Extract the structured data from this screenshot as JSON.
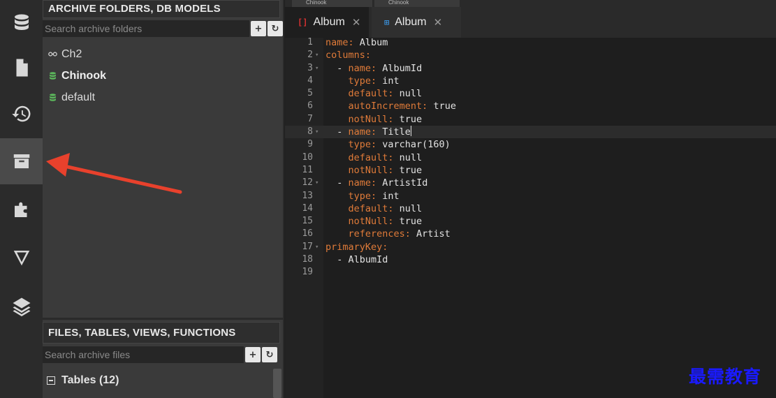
{
  "rail": {
    "items": [
      {
        "icon": "database-icon"
      },
      {
        "icon": "document-icon"
      },
      {
        "icon": "history-icon"
      },
      {
        "icon": "archive-icon",
        "active": true
      },
      {
        "icon": "puzzle-icon"
      },
      {
        "icon": "filter-icon"
      },
      {
        "icon": "layers-icon"
      }
    ]
  },
  "archive_panel": {
    "title": "ARCHIVE FOLDERS, DB MODELS",
    "search_placeholder": "Search archive folders",
    "add_label": "+",
    "refresh_label": "↻",
    "folders": [
      {
        "label": "Ch2",
        "icon": "link-icon",
        "bold": false
      },
      {
        "label": "Chinook",
        "icon": "db-green-icon",
        "bold": true
      },
      {
        "label": "default",
        "icon": "db-green-icon",
        "bold": false
      }
    ]
  },
  "files_panel": {
    "title": "FILES, TABLES, VIEWS, FUNCTIONS",
    "search_placeholder": "Search archive files",
    "add_label": "+",
    "refresh_label": "↻",
    "tables_label": "Tables (12)"
  },
  "editor": {
    "mini_tabs": [
      "Chinook",
      "Chinook"
    ],
    "tabs": [
      {
        "label": "Album",
        "icon": "[]",
        "icon_color": "#d03030",
        "active": true
      },
      {
        "label": "Album",
        "icon": "⊞",
        "icon_color": "#3a8fd8",
        "active": false
      }
    ],
    "lines": [
      {
        "n": "1",
        "fold": "",
        "parts": [
          [
            "k",
            "name: "
          ],
          [
            "v",
            "Album"
          ]
        ]
      },
      {
        "n": "2",
        "fold": "▾",
        "parts": [
          [
            "k",
            "columns:"
          ]
        ]
      },
      {
        "n": "3",
        "fold": "▾",
        "parts": [
          [
            "v",
            "  - "
          ],
          [
            "k",
            "name: "
          ],
          [
            "v",
            "AlbumId"
          ]
        ]
      },
      {
        "n": "4",
        "fold": "",
        "parts": [
          [
            "k",
            "    type: "
          ],
          [
            "v",
            "int"
          ]
        ]
      },
      {
        "n": "5",
        "fold": "",
        "parts": [
          [
            "k",
            "    default: "
          ],
          [
            "v",
            "null"
          ]
        ]
      },
      {
        "n": "6",
        "fold": "",
        "parts": [
          [
            "k",
            "    autoIncrement: "
          ],
          [
            "v",
            "true"
          ]
        ]
      },
      {
        "n": "7",
        "fold": "",
        "parts": [
          [
            "k",
            "    notNull: "
          ],
          [
            "v",
            "true"
          ]
        ]
      },
      {
        "n": "8",
        "fold": "▾",
        "parts": [
          [
            "v",
            "  - "
          ],
          [
            "k",
            "name: "
          ],
          [
            "v",
            "Title"
          ]
        ],
        "highlight": true
      },
      {
        "n": "9",
        "fold": "",
        "parts": [
          [
            "k",
            "    type: "
          ],
          [
            "v",
            "varchar(160)"
          ]
        ]
      },
      {
        "n": "10",
        "fold": "",
        "parts": [
          [
            "k",
            "    default: "
          ],
          [
            "v",
            "null"
          ]
        ]
      },
      {
        "n": "11",
        "fold": "",
        "parts": [
          [
            "k",
            "    notNull: "
          ],
          [
            "v",
            "true"
          ]
        ]
      },
      {
        "n": "12",
        "fold": "▾",
        "parts": [
          [
            "v",
            "  - "
          ],
          [
            "k",
            "name: "
          ],
          [
            "v",
            "ArtistId"
          ]
        ]
      },
      {
        "n": "13",
        "fold": "",
        "parts": [
          [
            "k",
            "    type: "
          ],
          [
            "v",
            "int"
          ]
        ]
      },
      {
        "n": "14",
        "fold": "",
        "parts": [
          [
            "k",
            "    default: "
          ],
          [
            "v",
            "null"
          ]
        ]
      },
      {
        "n": "15",
        "fold": "",
        "parts": [
          [
            "k",
            "    notNull: "
          ],
          [
            "v",
            "true"
          ]
        ]
      },
      {
        "n": "16",
        "fold": "",
        "parts": [
          [
            "k",
            "    references: "
          ],
          [
            "v",
            "Artist"
          ]
        ]
      },
      {
        "n": "17",
        "fold": "▾",
        "parts": [
          [
            "k",
            "primaryKey:"
          ]
        ]
      },
      {
        "n": "18",
        "fold": "",
        "parts": [
          [
            "v",
            "  - AlbumId"
          ]
        ]
      },
      {
        "n": "19",
        "fold": "",
        "parts": []
      }
    ]
  },
  "watermark": "最需教育",
  "colors": {
    "accent_arrow": "#e8412c",
    "key": "#e07b39",
    "db_green": "#5cb85c"
  }
}
